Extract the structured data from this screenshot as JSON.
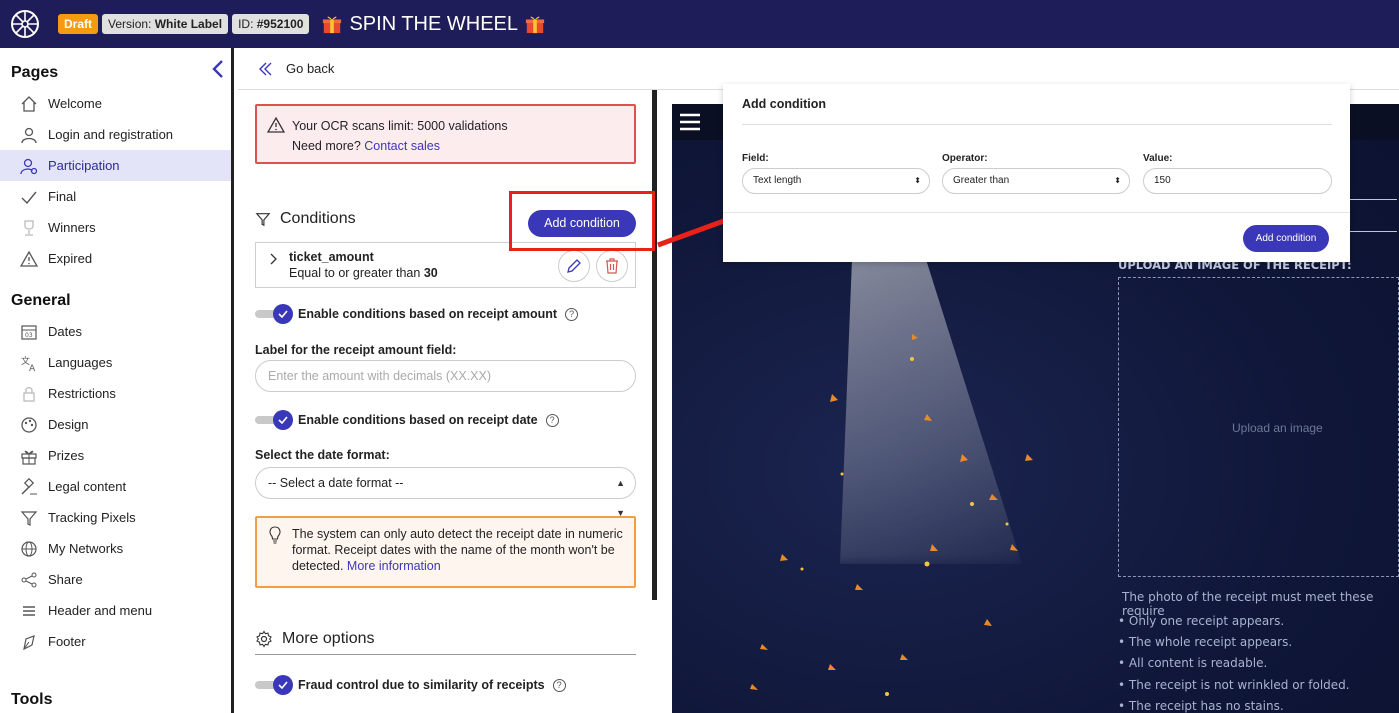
{
  "topbar": {
    "draft": "Draft",
    "version_prefix": "Version:",
    "version_value": "White Label",
    "id_prefix": "ID:",
    "id_value": "#952100",
    "title": "SPIN THE WHEEL"
  },
  "sidebar": {
    "pages_heading": "Pages",
    "pages": [
      {
        "label": "Welcome",
        "icon": "home-icon"
      },
      {
        "label": "Login and registration",
        "icon": "user-icon"
      },
      {
        "label": "Participation",
        "icon": "user-gear-icon",
        "active": true
      },
      {
        "label": "Final",
        "icon": "check-icon"
      },
      {
        "label": "Winners",
        "icon": "trophy-icon"
      },
      {
        "label": "Expired",
        "icon": "warning-icon"
      }
    ],
    "general_heading": "General",
    "general": [
      {
        "label": "Dates",
        "icon": "calendar-icon"
      },
      {
        "label": "Languages",
        "icon": "translate-icon"
      },
      {
        "label": "Restrictions",
        "icon": "lock-icon"
      },
      {
        "label": "Design",
        "icon": "palette-icon"
      },
      {
        "label": "Prizes",
        "icon": "gift-icon"
      },
      {
        "label": "Legal content",
        "icon": "gavel-icon"
      },
      {
        "label": "Tracking Pixels",
        "icon": "filter-icon"
      },
      {
        "label": "My Networks",
        "icon": "globe-icon"
      },
      {
        "label": "Share",
        "icon": "share-icon"
      },
      {
        "label": "Header and menu",
        "icon": "menu-icon"
      },
      {
        "label": "Footer",
        "icon": "footer-icon"
      }
    ],
    "tools_heading": "Tools"
  },
  "goback": "Go back",
  "ocr_alert": {
    "line1": "Your OCR scans limit: 5000 validations",
    "line2_prefix": "Need more?",
    "line2_link": "Contact sales"
  },
  "conditions": {
    "title": "Conditions",
    "add_button": "Add condition",
    "items": [
      {
        "name": "ticket_amount",
        "description": "Equal to or greater than",
        "value": "30"
      }
    ]
  },
  "receipt_amount": {
    "toggle_label": "Enable conditions based on receipt amount",
    "field_label": "Label for the receipt amount field:",
    "placeholder": "Enter the amount with decimals (XX.XX)"
  },
  "receipt_date": {
    "toggle_label": "Enable conditions based on receipt date",
    "format_label": "Select the date format:",
    "format_value": "-- Select a date format --"
  },
  "date_alert": {
    "text": "The system can only auto detect the receipt date in numeric format. Receipt dates with the name of the month won't be detected.",
    "link": "More information"
  },
  "more_options": {
    "title": "More options",
    "fraud_label": "Fraud control due to similarity of receipts"
  },
  "modal": {
    "title": "Add condition",
    "field_label": "Field:",
    "field_value": "Text length",
    "operator_label": "Operator:",
    "operator_value": "Greater than",
    "value_label": "Value:",
    "value_value": "150",
    "button": "Add condition"
  },
  "preview": {
    "upload_heading": "UPLOAD AN IMAGE OF THE RECEIPT:",
    "upload_placeholder": "Upload an image",
    "requirements_intro": "The photo of the receipt must meet these require",
    "requirements": [
      "Only one receipt appears.",
      "The whole receipt appears.",
      "All content is readable.",
      "The receipt is not wrinkled or folded.",
      "The receipt has no stains."
    ]
  },
  "colors": {
    "topbar": "#1f1d59",
    "accent": "#3a37b8",
    "highlight_red": "#e8211a",
    "draft_badge": "#f39c12"
  }
}
